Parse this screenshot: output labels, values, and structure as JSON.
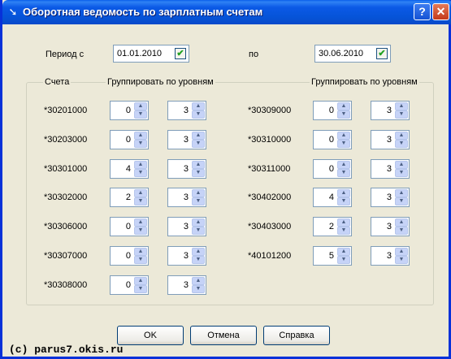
{
  "window": {
    "title": "Оборотная ведомость по зарплатным счетам"
  },
  "period": {
    "from_label": "Период с",
    "from_value": "01.01.2010",
    "to_label": "по",
    "to_value": "30.06.2010"
  },
  "group": {
    "accounts_label": "Счета",
    "levels_label_left": "Группировать по уровням",
    "levels_label_right": "Группировать по уровням"
  },
  "accounts_left": [
    {
      "code": "*30201000",
      "v1": "0",
      "v2": "3"
    },
    {
      "code": "*30203000",
      "v1": "0",
      "v2": "3"
    },
    {
      "code": "*30301000",
      "v1": "4",
      "v2": "3"
    },
    {
      "code": "*30302000",
      "v1": "2",
      "v2": "3"
    },
    {
      "code": "*30306000",
      "v1": "0",
      "v2": "3"
    },
    {
      "code": "*30307000",
      "v1": "0",
      "v2": "3"
    },
    {
      "code": "*30308000",
      "v1": "0",
      "v2": "3"
    }
  ],
  "accounts_right": [
    {
      "code": "*30309000",
      "v1": "0",
      "v2": "3"
    },
    {
      "code": "*30310000",
      "v1": "0",
      "v2": "3"
    },
    {
      "code": "*30311000",
      "v1": "0",
      "v2": "3"
    },
    {
      "code": "*30402000",
      "v1": "4",
      "v2": "3"
    },
    {
      "code": "*30403000",
      "v1": "2",
      "v2": "3"
    },
    {
      "code": "*40101200",
      "v1": "5",
      "v2": "3"
    }
  ],
  "buttons": {
    "ok": "OK",
    "cancel": "Отмена",
    "help": "Справка"
  },
  "footer": "(c) parus7.okis.ru"
}
